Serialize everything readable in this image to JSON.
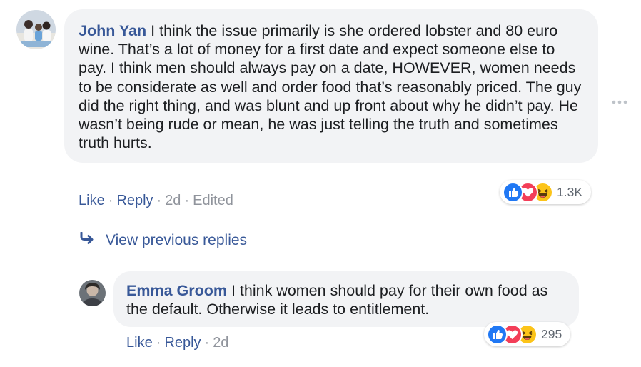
{
  "comment": {
    "author": "John Yan",
    "text": " I think the issue primarily is she ordered lobster and 80 euro wine. That’s a lot of money for a first date and expect someone else to pay. I think men should always pay on a date, HOWEVER, women needs to be considerate as well and order food that’s reasonably priced. The guy did the right thing, and was blunt and up front about why he didn’t pay. He wasn’t being rude or mean, he was just telling the truth and sometimes truth hurts.",
    "like_label": "Like",
    "reply_label": "Reply",
    "time": "2d",
    "edited_label": "Edited",
    "reaction_count": "1.3K",
    "reaction_icons": [
      "like-icon",
      "love-icon",
      "haha-icon"
    ]
  },
  "view_previous": {
    "icon": "reply-arrow-icon",
    "label": "View previous replies"
  },
  "reply": {
    "author": "Emma Groom",
    "text": " I think women should pay for their own food as the default. Otherwise it leads to entitlement.",
    "like_label": "Like",
    "reply_label": "Reply",
    "time": "2d",
    "reaction_count": "295",
    "reaction_icons": [
      "like-icon",
      "love-icon",
      "haha-icon"
    ]
  },
  "separator": "·",
  "colors": {
    "link": "#385898",
    "bubble": "#f2f3f5",
    "muted": "#90949c",
    "like": "#2078f4",
    "love": "#f33e58",
    "haha": "#fcc419"
  }
}
